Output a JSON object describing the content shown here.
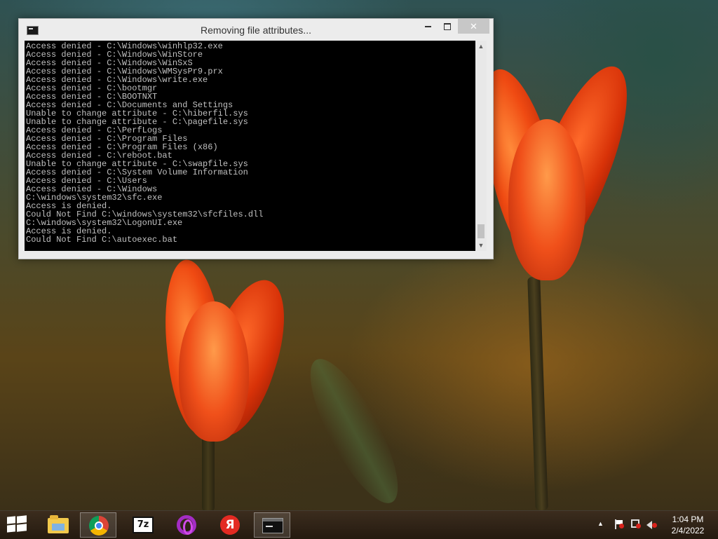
{
  "window": {
    "title": "Removing file attributes...",
    "console_lines": [
      "Access denied - C:\\Windows\\winhlp32.exe",
      "Access denied - C:\\Windows\\WinStore",
      "Access denied - C:\\Windows\\WinSxS",
      "Access denied - C:\\Windows\\WMSysPr9.prx",
      "Access denied - C:\\Windows\\write.exe",
      "Access denied - C:\\bootmgr",
      "Access denied - C:\\BOOTNXT",
      "Access denied - C:\\Documents and Settings",
      "Unable to change attribute - C:\\hiberfil.sys",
      "Unable to change attribute - C:\\pagefile.sys",
      "Access denied - C:\\PerfLogs",
      "Access denied - C:\\Program Files",
      "Access denied - C:\\Program Files (x86)",
      "Access denied - C:\\reboot.bat",
      "Unable to change attribute - C:\\swapfile.sys",
      "Access denied - C:\\System Volume Information",
      "Access denied - C:\\Users",
      "Access denied - C:\\Windows",
      "C:\\windows\\system32\\sfc.exe",
      "Access is denied.",
      "Could Not Find C:\\windows\\system32\\sfcfiles.dll",
      "C:\\windows\\system32\\LogonUI.exe",
      "Access is denied.",
      "Could Not Find C:\\autoexec.bat"
    ],
    "close_glyph": "✕"
  },
  "taskbar": {
    "apps": [
      {
        "name": "file-explorer",
        "icon": "folder-icon"
      },
      {
        "name": "google-chrome",
        "icon": "chrome-icon",
        "active": true
      },
      {
        "name": "7-zip",
        "icon": "7zip-icon",
        "label": "7z"
      },
      {
        "name": "opera",
        "icon": "opera-icon"
      },
      {
        "name": "yandex-browser",
        "icon": "yandex-icon",
        "label": "Я"
      },
      {
        "name": "command-prompt",
        "icon": "cmd-icon",
        "active": true
      }
    ],
    "tray": {
      "up_arrow": "▲",
      "time": "1:04 PM",
      "date": "2/4/2022"
    }
  },
  "colors": {
    "console_bg": "#000000",
    "console_text": "#c0c0c0",
    "close_button": "#c7c7c7"
  }
}
